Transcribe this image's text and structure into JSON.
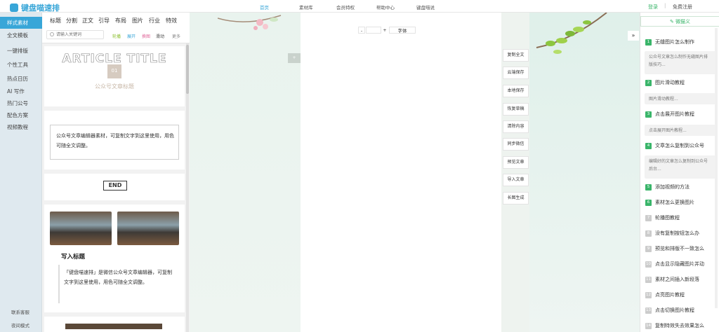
{
  "brand": {
    "name": "键盘喵速排"
  },
  "nav": [
    {
      "label": "首页",
      "active": true
    },
    {
      "label": "素材库"
    },
    {
      "label": "会员特权"
    },
    {
      "label": "帮助中心"
    },
    {
      "label": "键盘喵说"
    }
  ],
  "account": {
    "login": "登录",
    "divider": "|",
    "register": "免费注册"
  },
  "sidebar": {
    "items": [
      "样式素材",
      "全文模板",
      "一键排版",
      "个性工具",
      "热点日历",
      "AI 写作",
      "热门公号",
      "配色方案",
      "视频教程"
    ],
    "bottom": [
      "联系客服",
      "夜间模式"
    ]
  },
  "material": {
    "tabs": [
      "标题",
      "分割",
      "正文",
      "引导",
      "布局",
      "图片",
      "行业",
      "特效"
    ],
    "swap_label": "换色",
    "search_placeholder": "请输入关键词",
    "filters": [
      {
        "label": "轮播",
        "color": "#8bbf2e"
      },
      {
        "label": "展开",
        "color": "#38a6d8"
      },
      {
        "label": "换图",
        "color": "#e0679a"
      },
      {
        "label": "滑动",
        "color": "#444444"
      },
      {
        "label": "更多",
        "color": "#888888"
      }
    ],
    "cards": {
      "article_title": "ARTICLE TITLE",
      "number": "01",
      "pub_title": "公众号文章标题",
      "body_text": "公众号文章编辑器素材，可复制文字到这里使用，用色可随全文调整。",
      "end_label": "END",
      "write_title": "写入标题",
      "write_text": "「键盘喵速排」是微信公众号文章编辑器，可复制文字到这里使用，用色可随全文调整。"
    }
  },
  "editor": {
    "font_minus": "-",
    "font_plus": "+",
    "font_label": "字体",
    "paste_tab": "+"
  },
  "actions": [
    "复制全文",
    "云端保存",
    "本地保存",
    "恢复草稿",
    "清除内容",
    "同步微信",
    "预览文章",
    "导入文章",
    "长图生成"
  ],
  "collapse": "»",
  "qa": {
    "header": "微猫义",
    "items": [
      {
        "num": "1",
        "title": "无缝图片怎么制作",
        "answer": "公众号文章怎么制作无缝图片排版技巧...",
        "hot": true
      },
      {
        "num": "2",
        "title": "图片滑动教程",
        "answer": "图片滑动教程...",
        "hot": true
      },
      {
        "num": "3",
        "title": "点击展开图片教程",
        "answer": "点击展开图片教程...",
        "hot": true
      },
      {
        "num": "4",
        "title": "文章怎么复制到公众号",
        "answer": "编辑好的文章怎么复制到公众号后台...",
        "hot": true
      },
      {
        "num": "5",
        "title": "添加视频的方法",
        "hot": true
      },
      {
        "num": "6",
        "title": "素材怎么更换图片",
        "hot": true
      },
      {
        "num": "7",
        "title": "轮播图教程",
        "hot": false
      },
      {
        "num": "8",
        "title": "没有复制按钮怎么办",
        "hot": false
      },
      {
        "num": "9",
        "title": "预览和排版不一致怎么",
        "hot": false
      },
      {
        "num": "10",
        "title": "点击显示隐藏图片并动",
        "hot": false
      },
      {
        "num": "11",
        "title": "素材之间插入新段落",
        "hot": false
      },
      {
        "num": "12",
        "title": "点亮图片教程",
        "hot": false
      },
      {
        "num": "13",
        "title": "点击切换图片教程",
        "hot": false
      },
      {
        "num": "14",
        "title": "复制特效失去效果怎么",
        "hot": false
      }
    ]
  },
  "colors": {
    "accent": "#38a6d8",
    "green": "#3ab56a",
    "badge_muted": "#cccccc"
  }
}
